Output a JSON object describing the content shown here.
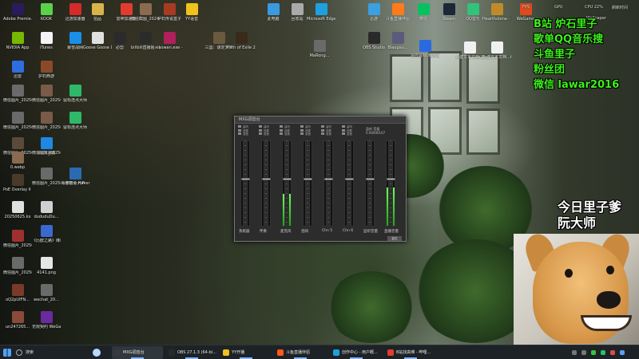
{
  "desktop_icons": [
    {
      "label": "Adobe Premie...",
      "icon": "premiere-icon",
      "color": "#2a1b5c"
    },
    {
      "label": "KOOK",
      "icon": "kook-icon",
      "color": "#5ad14a"
    },
    {
      "label": "迅游加速器",
      "icon": "game-accelerator-icon",
      "color": "#d42a2a"
    },
    {
      "label": "拍品",
      "icon": "folder-icon",
      "color": "#d8b34a"
    },
    {
      "label": "雷神加速器",
      "icon": "leishen-icon",
      "color": "#e23c2e"
    },
    {
      "label": "微信截图_2024071...",
      "icon": "screenshot-icon",
      "color": "#8a6a50"
    },
    {
      "label": "炉石传说盒子",
      "icon": "hearthstone-box-icon",
      "color": "#a83a22"
    },
    {
      "label": "YY语音",
      "icon": "yy-icon",
      "color": "#f0c21a"
    },
    {
      "label": "NVIDIA App",
      "icon": "nvidia-icon",
      "color": "#76b900"
    },
    {
      "label": "iTunes",
      "icon": "itunes-icon",
      "color": "#f4f4f4"
    },
    {
      "label": "暴雪战网",
      "icon": "battlenet-icon",
      "color": "#1a8ee8"
    },
    {
      "label": "Goose Goose Duck",
      "icon": "goose-icon",
      "color": "#e0e0e0"
    },
    {
      "label": "必剪",
      "icon": "bijian-icon",
      "color": "#2b2b2b"
    },
    {
      "label": "bilibili直播姬 - 快捷方式",
      "icon": "bilibili-icon",
      "color": "#2b2b2b"
    },
    {
      "label": "xiaowan.exe - 快捷方式",
      "icon": "xiaowan-icon",
      "color": "#b0205a"
    },
    {
      "label": "三国：谋定天下",
      "icon": "sanguo-icon",
      "color": "#6a5a40"
    },
    {
      "label": "Path of Exile 2",
      "icon": "poe2-icon",
      "color": "#3a2a1a"
    },
    {
      "label": "迅雷",
      "icon": "xunlei-icon",
      "color": "#2f6ee0"
    },
    {
      "label": "护石西游",
      "icon": "game-icon",
      "color": "#8a4a2a"
    },
    {
      "label": "微信图片_2025072...",
      "icon": "image-icon",
      "color": "#6a6a6a"
    },
    {
      "label": "微信图片_2025072...",
      "icon": "image-icon",
      "color": "#7a5a48"
    },
    {
      "label": "鼠标连点大师",
      "icon": "autoclicker-icon",
      "color": "#2fb86a"
    },
    {
      "label": "微信图片_2025080...",
      "icon": "image-icon",
      "color": "#6a6a6a"
    },
    {
      "label": "微信图片_2025072...",
      "icon": "image-icon",
      "color": "#7a5a48"
    },
    {
      "label": "鼠标连点大师",
      "icon": "autoclicker-icon",
      "color": "#2fb86a"
    },
    {
      "label": "微信图片_2025080...",
      "icon": "image-icon",
      "color": "#5a4a3a"
    },
    {
      "label": "微信图片_2025072...",
      "icon": "image-icon",
      "color": "#6a6a6a"
    },
    {
      "label": "0.webp",
      "icon": "image-icon",
      "color": "#8a6a50"
    },
    {
      "label": "UU加速器",
      "icon": "uu-icon",
      "color": "#1e88e5"
    },
    {
      "label": "燕云十六声",
      "icon": "yanyun-icon",
      "color": "#8a7a6a"
    },
    {
      "label": "PoE Overlay II Standal...",
      "icon": "poe-overlay-icon",
      "color": "#4a3a2a"
    },
    {
      "label": "微信图片_2025073...",
      "icon": "image-icon",
      "color": "#6a6a6a"
    },
    {
      "label": "海港物语 Havendock",
      "icon": "havendock-icon",
      "color": "#2a6ab0"
    },
    {
      "label": "20250625.kx",
      "icon": "file-icon",
      "color": "#e0e0e0"
    },
    {
      "label": "dududuDu...",
      "icon": "file-icon",
      "color": "#d0d0d0"
    },
    {
      "label": "微信图片_2025062...",
      "icon": "image-icon",
      "color": "#a03030"
    },
    {
      "label": "《历欧之路》降临：竞争...",
      "icon": "document-icon",
      "color": "#3a6ad0"
    },
    {
      "label": "4141.png",
      "icon": "image-icon",
      "color": "#e6e6e6"
    },
    {
      "label": "微信图片_2025091...",
      "icon": "image-icon",
      "color": "#6a6a6a"
    },
    {
      "label": "oQ2pUIFN...",
      "icon": "image-icon",
      "color": "#7a3a2a"
    },
    {
      "label": "wechat_20...",
      "icon": "image-icon",
      "color": "#6a6a6a"
    },
    {
      "label": "un247265...",
      "icon": "image-icon",
      "color": "#8a4a3a"
    },
    {
      "label": "无限契约 WeGame版",
      "icon": "wegame-icon",
      "color": "#6a2aa0"
    },
    {
      "label": "此电脑",
      "icon": "pc-icon",
      "color": "#3a9ae0"
    },
    {
      "label": "回收站",
      "icon": "recycle-bin-icon",
      "color": "#aaaaaa"
    },
    {
      "label": "Microsoft Edge",
      "icon": "edge-icon",
      "color": "#1ea0e0"
    },
    {
      "label": "MaRong...",
      "icon": "file-icon",
      "color": "#6a6a6a"
    },
    {
      "label": "Steam",
      "icon": "steam-icon",
      "color": "#1b2838"
    },
    {
      "label": "QQ音乐",
      "icon": "qq-music-icon",
      "color": "#31c27c"
    },
    {
      "label": "Blaugeu...",
      "icon": "file-icon",
      "color": "#5a5a7a"
    },
    {
      "label": "遥控鼠标(精简版)",
      "icon": "remote-mouse-icon",
      "color": "#2a6ae0"
    },
    {
      "label": "新建文本文档(3).txt",
      "icon": "text-file-icon",
      "color": "#f0f0f0"
    },
    {
      "label": "新建文本文档...txt",
      "icon": "text-file-icon",
      "color": "#f0f0f0"
    },
    {
      "label": "Hearthstone - 快捷方式",
      "icon": "hearthstone-icon",
      "color": "#c08a2a"
    },
    {
      "label": "WeGame",
      "icon": "wegame-icon",
      "color": "#e04a1a"
    },
    {
      "label": "迅游",
      "icon": "xunyou-icon",
      "color": "#3aa0e0"
    },
    {
      "label": "微信",
      "icon": "wechat-icon",
      "color": "#07c160"
    },
    {
      "label": "OBS Studio",
      "icon": "obs-icon",
      "color": "#2a2a2a"
    },
    {
      "label": "斗鱼直播伴侣",
      "icon": "douyu-icon",
      "color": "#ff7a1a"
    }
  ],
  "overlay": {
    "lines": [
      "B站  炉石里子",
      "歌单QQ音乐搜",
      "斗鱼里子",
      "粉丝团",
      "微信  lawar2016"
    ],
    "caption": [
      "今日里子爹",
      "阮大师"
    ]
  },
  "tray_top": {
    "fps": "FPS",
    "gpu": "GPU",
    "cpu": "CPU 22%",
    "time": "刷新时间",
    "wallpaper": "Wallpaper",
    "cpu_label": "CPU"
  },
  "mixer": {
    "title": "MXG调音台",
    "readout": {
      "line1": "监听 音量",
      "line2": "0.00000167"
    },
    "top_controls": [
      {
        "a": "监听",
        "b": "闭麦",
        "c": "混音"
      },
      {
        "a": "监听",
        "b": "闭麦",
        "c": "混音"
      },
      {
        "a": "监听",
        "b": "闭麦",
        "c": "混音"
      },
      {
        "a": "监听",
        "b": "闭麦",
        "c": "混音"
      },
      {
        "a": "监听",
        "b": "闭麦",
        "c": "混音"
      },
      {
        "a": "监听",
        "b": "闭麦",
        "c": "混音"
      }
    ],
    "channels": [
      {
        "label": "系统器",
        "level": 0.0,
        "fader": 0.55
      },
      {
        "label": "伴奏",
        "level": 0.0,
        "fader": 0.55
      },
      {
        "label": "麦克风",
        "level": 0.38,
        "fader": 0.55
      },
      {
        "label": "混响",
        "level": 0.0,
        "fader": 0.55
      },
      {
        "label": "Chn 5",
        "level": 0.0,
        "fader": 0.55
      },
      {
        "label": "Chn 6",
        "level": 0.0,
        "fader": 0.55
      },
      {
        "label": "监听音量",
        "level": 0.0,
        "fader": 0.55
      },
      {
        "label": "直播音量",
        "level": 0.45,
        "fader": 0.55
      }
    ],
    "reset_label": "复位"
  },
  "taskbar": {
    "search_label": "搜索",
    "apps": [
      {
        "label": "MXG调音台",
        "icon": "mixer-icon",
        "color": "#3a3a3a",
        "active": true
      },
      {
        "label": "OBS 27.1.3 (64-bi...",
        "icon": "obs-icon",
        "color": "#2a2a2a",
        "active": true
      },
      {
        "label": "YY开播",
        "icon": "yy-icon",
        "color": "#f0c21a",
        "active": true
      },
      {
        "label": "斗鱼直播伴侣",
        "icon": "douyu-icon",
        "color": "#ff5a1a",
        "active": true
      },
      {
        "label": "创作中心 - 用户概...",
        "icon": "edge-icon",
        "color": "#1ea0e0",
        "active": true
      },
      {
        "label": "B站找高难 - 哔哩...",
        "icon": "edge-icon",
        "color": "#e23c2e",
        "active": true
      }
    ]
  }
}
